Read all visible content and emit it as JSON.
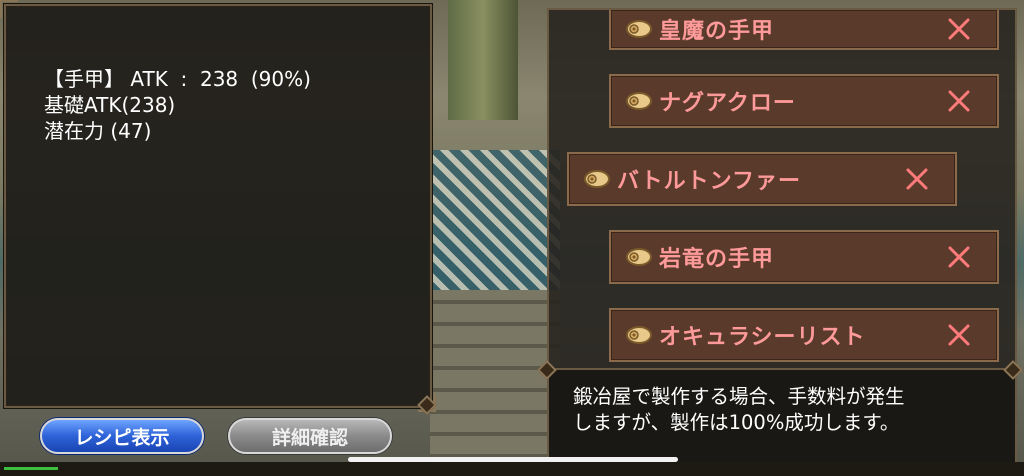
{
  "info": {
    "lines": [
      "【手甲】 ATK  :  238  (90%)",
      "基礎ATK(238)",
      "潜在力 (47)"
    ]
  },
  "buttons": {
    "recipe": "レシピ表示",
    "detail": "詳細確認"
  },
  "recipe_list": [
    {
      "name": "皇魔の手甲"
    },
    {
      "name": "ナグアクロー"
    },
    {
      "name": "バトルトンファー"
    },
    {
      "name": "岩竜の手甲"
    },
    {
      "name": "オキュラシーリスト"
    }
  ],
  "description": {
    "line1": "鍛冶屋で製作する場合、手数料が発生",
    "line2": "しますが、製作は100%成功します。"
  },
  "colors": {
    "item_label": "#ff9a9a",
    "remove_x": "#ff7a7a",
    "item_bg": "#5a3a2b"
  },
  "icons": {
    "item": "scroll-icon",
    "remove": "close-icon"
  }
}
